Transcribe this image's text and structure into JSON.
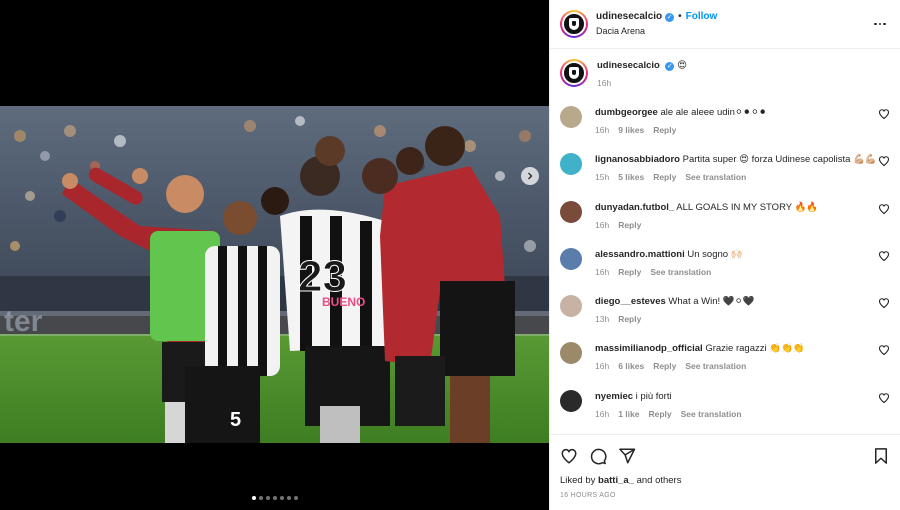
{
  "header": {
    "username": "udinesecalcio",
    "separator": "•",
    "follow_label": "Follow",
    "location": "Dacia Arena",
    "more_icon": "more-horizontal-icon"
  },
  "caption": {
    "username": "udinesecalcio",
    "text": "😍",
    "time": "16h"
  },
  "comments": [
    {
      "username": "dumbgeorgee",
      "text": "ale ale aleee udin⚪⚫⚪⚫",
      "time": "16h",
      "likes": "9 likes",
      "reply": "Reply",
      "translate": "",
      "avatar_color": "#b9a98c"
    },
    {
      "username": "lignanosabbiadoro",
      "text": "Partita super 😍 forza Udinese capolista 💪🏼💪🏼",
      "time": "15h",
      "likes": "5 likes",
      "reply": "Reply",
      "translate": "See translation",
      "avatar_color": "#3fb2c9"
    },
    {
      "username": "dunyadan.futbol_",
      "text": "ALL GOALS IN MY STORY 🔥🔥",
      "time": "16h",
      "likes": "",
      "reply": "Reply",
      "translate": "",
      "avatar_color": "#7a4a3a"
    },
    {
      "username": "alessandro.mattioni",
      "text": "Un sogno 🙌🏻",
      "time": "16h",
      "likes": "",
      "reply": "Reply",
      "translate": "See translation",
      "avatar_color": "#5b7dab"
    },
    {
      "username": "diego__esteves",
      "text": "What a Win! 🖤⚪🖤",
      "time": "13h",
      "likes": "",
      "reply": "Reply",
      "translate": "",
      "avatar_color": "#c7b2a4"
    },
    {
      "username": "massimilianodp_official",
      "text": "Grazie ragazzi 👏👏👏",
      "time": "16h",
      "likes": "6 likes",
      "reply": "Reply",
      "translate": "See translation",
      "avatar_color": "#9b8a6a"
    },
    {
      "username": "nyemiec",
      "text": "i più forti",
      "time": "16h",
      "likes": "1 like",
      "reply": "Reply",
      "translate": "See translation",
      "avatar_color": "#2a2a2a"
    }
  ],
  "footer": {
    "liked_by_prefix": "Liked by",
    "liked_by_user": "batti_a_",
    "liked_by_suffix": "and others",
    "time_ago": "16 HOURS AGO"
  },
  "icons": {
    "like": "heart-icon",
    "comment": "comment-icon",
    "share": "paper-plane-icon",
    "save": "bookmark-icon",
    "next": "chevron-right-icon"
  },
  "carousel": {
    "count": 7,
    "active": 1
  },
  "colors": {
    "link_blue": "#0095f6",
    "verified_blue": "#3897f0",
    "meta_grey": "#8e8e8e"
  }
}
